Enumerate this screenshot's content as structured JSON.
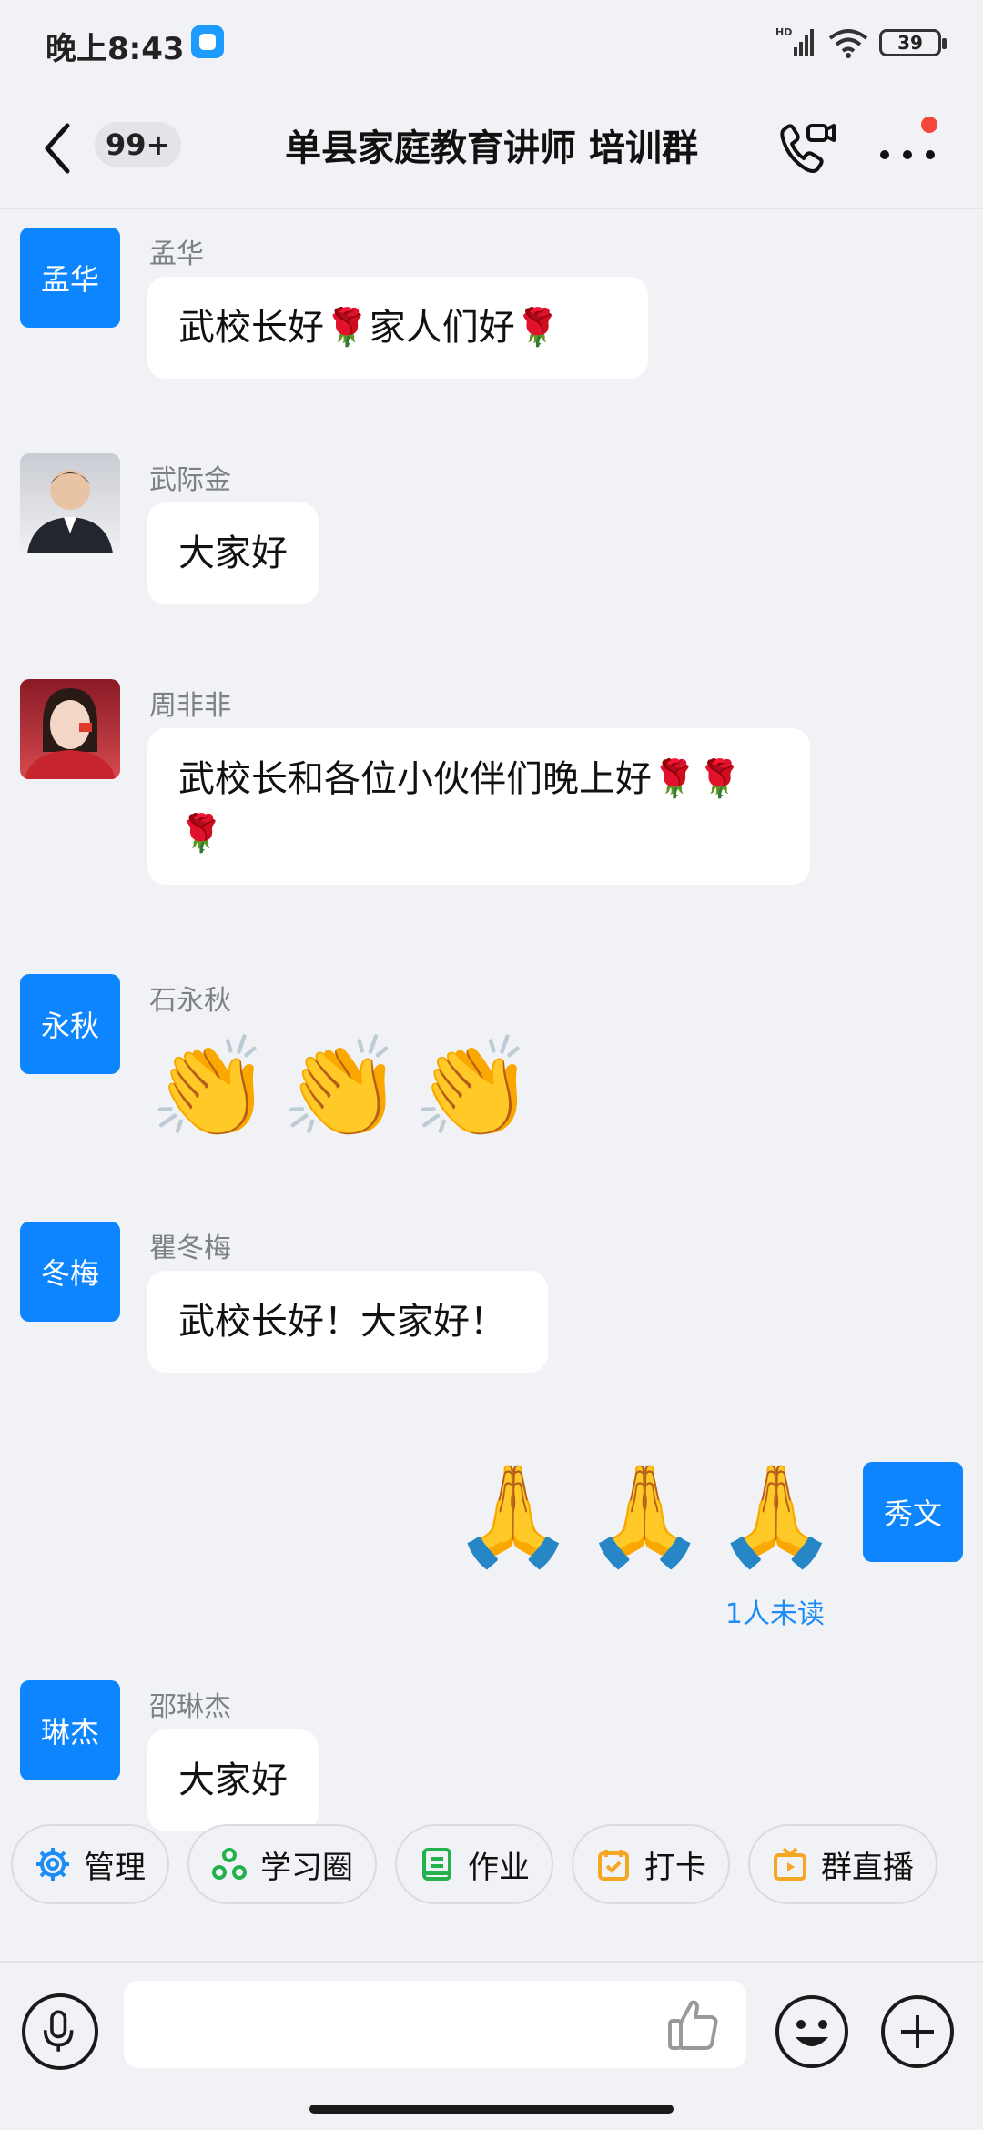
{
  "status_bar": {
    "time": "晚上8:43",
    "battery": "39",
    "hd_label": "HD"
  },
  "header": {
    "unread_count": "99+",
    "title": "单县家庭教育讲师 培训群"
  },
  "messages": [
    {
      "sender": "孟华",
      "avatar_text": "孟华",
      "text": "武校长好🌹家人们好🌹"
    },
    {
      "sender": "武际金",
      "avatar_text": "",
      "text": "大家好"
    },
    {
      "sender": "周非非",
      "avatar_text": "",
      "text": "武校长和各位小伙伴们晚上好🌹🌹🌹"
    },
    {
      "sender": "石永秋",
      "avatar_text": "永秋",
      "emojis": [
        "👏",
        "👏",
        "👏"
      ]
    },
    {
      "sender": "瞿冬梅",
      "avatar_text": "冬梅",
      "text": "武校长好！大家好！"
    },
    {
      "sender": "",
      "avatar_text": "秀文",
      "emojis": [
        "🙏",
        "🙏",
        "🙏"
      ],
      "status": "1人未读"
    },
    {
      "sender": "邵琳杰",
      "avatar_text": "琳杰",
      "text": "大家好"
    }
  ],
  "tools": [
    {
      "label": "管理",
      "icon": "gear-icon",
      "color": "#1d8cf5"
    },
    {
      "label": "学习圈",
      "icon": "circle-group-icon",
      "color": "#22b14c"
    },
    {
      "label": "作业",
      "icon": "notebook-icon",
      "color": "#22b14c"
    },
    {
      "label": "打卡",
      "icon": "calendar-check-icon",
      "color": "#f5a623"
    },
    {
      "label": "群直播",
      "icon": "tv-play-icon",
      "color": "#f5a623"
    }
  ],
  "input": {
    "placeholder": ""
  }
}
